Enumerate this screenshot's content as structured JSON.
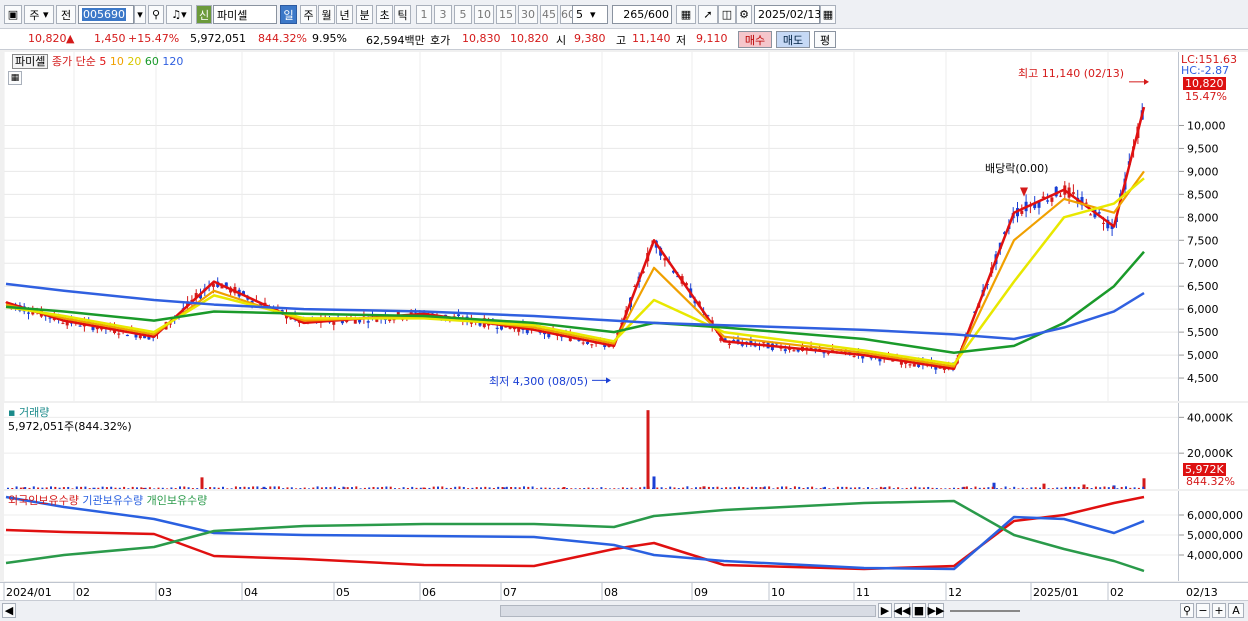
{
  "toolbar": {
    "market": "주",
    "prefix": "전",
    "code": "005690",
    "badge": "신",
    "name": "파미셀",
    "periods": [
      "일",
      "주",
      "월",
      "년",
      "분",
      "초",
      "틱"
    ],
    "numbers": [
      "1",
      "3",
      "5",
      "10",
      "15",
      "30",
      "45",
      "60"
    ],
    "unit_value": "5",
    "count": "265",
    "count_total": "/600",
    "date": "2025/02/13"
  },
  "quote": {
    "price": "10,820",
    "up_arrow": "▲",
    "change": "1,450",
    "change_pct": "+15.47%",
    "volume": "5,972,051",
    "volume_pct": "844.32%",
    "turnover": "9.95%",
    "amount": "62,594백만",
    "bid_label": "호가",
    "ask": "10,830",
    "bid": "10,820",
    "open_label": "시",
    "open": "9,380",
    "high_label": "고",
    "high": "11,140",
    "low_label": "저",
    "low": "9,110",
    "buy_label": "매수",
    "sell_label": "매도",
    "avg_label": "평"
  },
  "price_panel": {
    "stock_tag": "파미셀",
    "legend_prefix": "종가 단순",
    "ma_labels": [
      "5",
      "10",
      "20",
      "60",
      "120"
    ],
    "lc": "LC:151.63",
    "hc": "HC:-2.87",
    "current_box": "10,820",
    "current_pct": "15.47%",
    "high_annot": "최고 11,140 (02/13)",
    "low_annot": "최저 4,300 (08/05)",
    "dividend_annot": "배당락(0.00)"
  },
  "volume_panel": {
    "title": "거래량",
    "value_text": "5,972,051주(844.32%)",
    "current_box": "5,972K",
    "current_pct": "844.32%"
  },
  "holder_panel": {
    "legend": [
      "외국인보유수량",
      "기관보유수량",
      "개인보유수량"
    ]
  },
  "colors": {
    "up": "#d41a1a",
    "down": "#1a3fd4",
    "ma5": "#e01010",
    "ma10": "#f0a000",
    "ma20": "#e8e800",
    "ma60": "#1a9a2a",
    "ma120": "#3060e0",
    "foreign": "#e01010",
    "institution": "#2a60e0",
    "individual": "#2a9a4a"
  },
  "chart_data": [
    {
      "type": "line",
      "title": "",
      "x": [
        "2024/01",
        "02",
        "03",
        "04",
        "05",
        "06",
        "07",
        "08",
        "09",
        "10",
        "11",
        "12",
        "2025/01",
        "02"
      ],
      "ylim": [
        4000,
        11600
      ],
      "yticks": [
        "4,500",
        "5,000",
        "5,500",
        "6,000",
        "6,500",
        "7,000",
        "7,500",
        "8,000",
        "8,500",
        "9,000",
        "9,500",
        "10,000"
      ],
      "series": [
        {
          "name": "5",
          "values": [
            6150,
            5750,
            5400,
            6600,
            5700,
            5900,
            5550,
            5200,
            7500,
            5300,
            5000,
            4700,
            8100,
            8600,
            7800,
            10400
          ]
        },
        {
          "name": "10",
          "values": [
            6100,
            5800,
            5450,
            6400,
            5750,
            5850,
            5600,
            5250,
            6900,
            5400,
            5050,
            4750,
            7500,
            8400,
            8100,
            9000
          ]
        },
        {
          "name": "20",
          "values": [
            6050,
            5850,
            5500,
            6300,
            5800,
            5800,
            5650,
            5300,
            6200,
            5500,
            5100,
            4800,
            6600,
            8000,
            8300,
            8850
          ]
        },
        {
          "name": "60",
          "values": [
            6050,
            5950,
            5750,
            5950,
            5900,
            5850,
            5700,
            5500,
            5700,
            5600,
            5350,
            5050,
            5200,
            5700,
            6500,
            7250
          ]
        },
        {
          "name": "120",
          "values": [
            6550,
            6400,
            6200,
            6100,
            6000,
            5950,
            5850,
            5750,
            5700,
            5650,
            5550,
            5450,
            5350,
            5600,
            5950,
            6350
          ]
        }
      ]
    },
    {
      "type": "bar",
      "title": "",
      "ylim": [
        0,
        48000
      ],
      "yticks": [
        "20,000K",
        "40,000K"
      ],
      "values_k": [
        900,
        700,
        600,
        6500,
        1200,
        1000,
        800,
        900,
        1100,
        44000,
        7000,
        1500,
        1000,
        900,
        800,
        1200,
        3500,
        3000,
        2500,
        2000,
        5972
      ]
    },
    {
      "type": "line",
      "title": "",
      "ylim": [
        2700000,
        7200000
      ],
      "yticks": [
        "4,000,000",
        "5,000,000",
        "6,000,000"
      ],
      "series": [
        {
          "name": "외국인보유수량",
          "values": [
            5250000,
            5150000,
            5050000,
            3950000,
            3800000,
            3500000,
            3450000,
            4300000,
            4600000,
            3500000,
            3300000,
            3450000,
            5700000,
            6000000,
            6600000,
            6900000
          ]
        },
        {
          "name": "기관보유수량",
          "values": [
            6900000,
            6400000,
            5800000,
            5100000,
            5000000,
            4950000,
            4900000,
            4500000,
            4000000,
            3700000,
            3350000,
            3300000,
            5900000,
            5800000,
            5100000,
            5700000
          ]
        },
        {
          "name": "개인보유수량",
          "values": [
            3600000,
            4000000,
            4400000,
            5200000,
            5450000,
            5550000,
            5550000,
            5400000,
            5950000,
            6250000,
            6600000,
            6700000,
            5000000,
            4300000,
            3700000,
            3200000
          ]
        }
      ]
    }
  ]
}
